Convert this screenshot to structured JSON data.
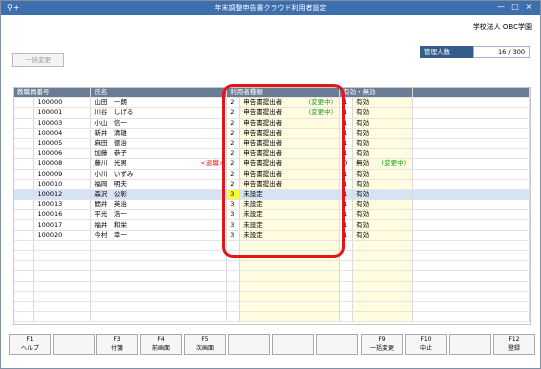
{
  "window": {
    "title": "年末調整申告書クラウド利用者設定",
    "controls": [
      "—",
      "□",
      "×"
    ]
  },
  "header": {
    "company": "学校法人 OBC学園",
    "bulk_change": "一括変更",
    "count_label": "管理人数",
    "count_value": "16 / 300"
  },
  "table": {
    "headers": [
      "教職員番号",
      "氏名",
      "利用者種類",
      "有効・無効"
    ],
    "rows": [
      {
        "id": "100000",
        "name": "山田　一朗",
        "retire": "",
        "type_num": "2",
        "type": "申告書提出者",
        "type_note": "(変更中)",
        "valid_num": "1",
        "valid": "有効",
        "valid_note": ""
      },
      {
        "id": "100001",
        "name": "川谷　しげる",
        "retire": "",
        "type_num": "2",
        "type": "申告書提出者",
        "type_note": "(変更中)",
        "valid_num": "1",
        "valid": "有効",
        "valid_note": ""
      },
      {
        "id": "100003",
        "name": "小山　信一",
        "retire": "",
        "type_num": "2",
        "type": "申告書提出者",
        "type_note": "",
        "valid_num": "1",
        "valid": "有効",
        "valid_note": ""
      },
      {
        "id": "100004",
        "name": "新井　清雄",
        "retire": "",
        "type_num": "2",
        "type": "申告書提出者",
        "type_note": "",
        "valid_num": "1",
        "valid": "有効",
        "valid_note": ""
      },
      {
        "id": "100005",
        "name": "麻田　徳治",
        "retire": "",
        "type_num": "2",
        "type": "申告書提出者",
        "type_note": "",
        "valid_num": "1",
        "valid": "有効",
        "valid_note": ""
      },
      {
        "id": "100006",
        "name": "加藤　恭子",
        "retire": "",
        "type_num": "2",
        "type": "申告書提出者",
        "type_note": "",
        "valid_num": "1",
        "valid": "有効",
        "valid_note": ""
      },
      {
        "id": "100008",
        "name": "藤川　光男",
        "retire": "<退職>",
        "type_num": "2",
        "type": "申告書提出者",
        "type_note": "",
        "valid_num": "0",
        "valid": "無効",
        "valid_note": "(変更中)"
      },
      {
        "id": "100009",
        "name": "小川　いずみ",
        "retire": "",
        "type_num": "2",
        "type": "申告書提出者",
        "type_note": "",
        "valid_num": "1",
        "valid": "有効",
        "valid_note": ""
      },
      {
        "id": "100010",
        "name": "福岡　明夫",
        "retire": "",
        "type_num": "2",
        "type": "申告書提出者",
        "type_note": "",
        "valid_num": "1",
        "valid": "有効",
        "valid_note": ""
      },
      {
        "id": "100012",
        "name": "森沢　公彰",
        "retire": "",
        "type_num": "3",
        "type": "未設定",
        "type_note": "",
        "valid_num": "1",
        "valid": "有効",
        "valid_note": ""
      },
      {
        "id": "100013",
        "name": "間井　英治",
        "retire": "",
        "type_num": "3",
        "type": "未設定",
        "type_note": "",
        "valid_num": "1",
        "valid": "有効",
        "valid_note": ""
      },
      {
        "id": "100016",
        "name": "平光　浩一",
        "retire": "",
        "type_num": "3",
        "type": "未設定",
        "type_note": "",
        "valid_num": "1",
        "valid": "有効",
        "valid_note": ""
      },
      {
        "id": "100017",
        "name": "福井　和栄",
        "retire": "",
        "type_num": "3",
        "type": "未設定",
        "type_note": "",
        "valid_num": "1",
        "valid": "有効",
        "valid_note": ""
      },
      {
        "id": "100020",
        "name": "今村　幸一",
        "retire": "",
        "type_num": "3",
        "type": "未設定",
        "type_note": "",
        "valid_num": "1",
        "valid": "有効",
        "valid_note": ""
      }
    ]
  },
  "fkeys": [
    {
      "key": "F1",
      "label": "ヘルプ"
    },
    {
      "key": "",
      "label": ""
    },
    {
      "key": "F3",
      "label": "付箋"
    },
    {
      "key": "F4",
      "label": "前画面"
    },
    {
      "key": "F5",
      "label": "次画面"
    },
    {
      "key": "",
      "label": ""
    },
    {
      "key": "",
      "label": ""
    },
    {
      "key": "",
      "label": ""
    },
    {
      "key": "F9",
      "label": "一括変更"
    },
    {
      "key": "F10",
      "label": "中止"
    },
    {
      "key": "",
      "label": ""
    },
    {
      "key": "F12",
      "label": "登録"
    }
  ]
}
